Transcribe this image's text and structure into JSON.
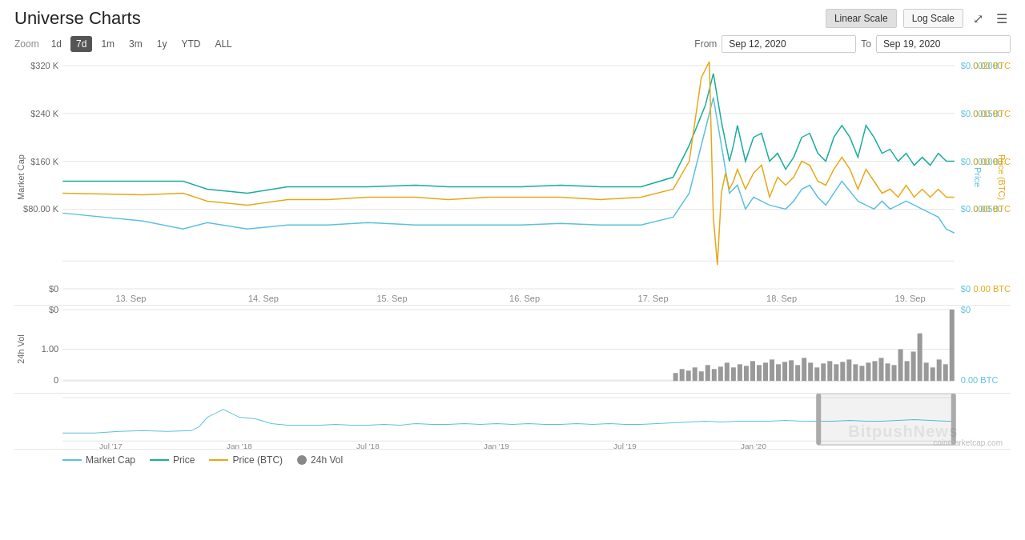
{
  "title": "Universe Charts",
  "header": {
    "linear_scale_label": "Linear Scale",
    "log_scale_label": "Log Scale"
  },
  "toolbar": {
    "zoom_label": "Zoom",
    "zoom_options": [
      "1d",
      "7d",
      "1m",
      "3m",
      "1y",
      "YTD",
      "ALL"
    ],
    "active_zoom": "7d",
    "from_label": "From",
    "to_label": "To",
    "from_date": "Sep 12, 2020",
    "to_date": "Sep 19, 2020"
  },
  "y_axis_left": {
    "labels": [
      "$320 K",
      "$240 K",
      "$160 K",
      "$80.00 K",
      "$0"
    ]
  },
  "y_axis_right_price": {
    "labels": [
      "$0.002000",
      "$0.001500",
      "$0.001000",
      "$0.000500",
      "$0"
    ]
  },
  "y_axis_right_btc": {
    "labels": [
      "0.00 BTC",
      "0.00 BTC",
      "0.00 BTC",
      "0.00 BTC",
      "0.00 BTC"
    ]
  },
  "x_axis_main": {
    "labels": [
      "13. Sep",
      "14. Sep",
      "15. Sep",
      "16. Sep",
      "17. Sep",
      "18. Sep",
      "19. Sep"
    ]
  },
  "y_axis_vol_left": {
    "labels": [
      "$0",
      "1.00",
      "0"
    ]
  },
  "y_axis_vol_right": {
    "labels": [
      "$0",
      "0.00 BTC"
    ]
  },
  "x_axis_mini": {
    "labels": [
      "Jul '17",
      "Jan '18",
      "Jul '18",
      "Jan '19",
      "Jul '19",
      "Jan '20"
    ]
  },
  "legend": {
    "items": [
      {
        "label": "Market Cap",
        "color": "#5bc0de",
        "type": "line"
      },
      {
        "label": "Price",
        "color": "#1aad9c",
        "type": "line"
      },
      {
        "label": "Price (BTC)",
        "color": "#e6a817",
        "type": "line"
      },
      {
        "label": "24h Vol",
        "color": "#888888",
        "type": "dot"
      }
    ]
  },
  "watermark": "BitpushNews",
  "attribution": "coinmarketcap.com"
}
